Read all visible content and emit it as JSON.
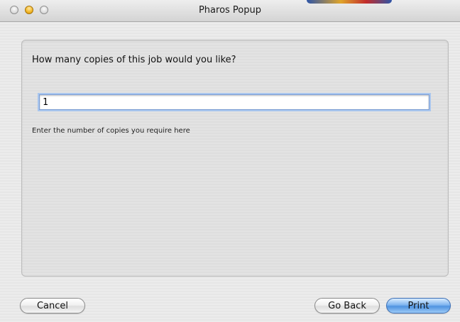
{
  "window": {
    "title": "Pharos Popup"
  },
  "dialog": {
    "question": "How many copies of this job would you like?",
    "copies_value": "1",
    "hint": "Enter the number of copies you require here"
  },
  "buttons": {
    "cancel_label": "Cancel",
    "go_back_label": "Go Back",
    "print_label": "Print"
  },
  "colors": {
    "accent": "#5a9be6",
    "minimize_button": "#f2b625"
  }
}
